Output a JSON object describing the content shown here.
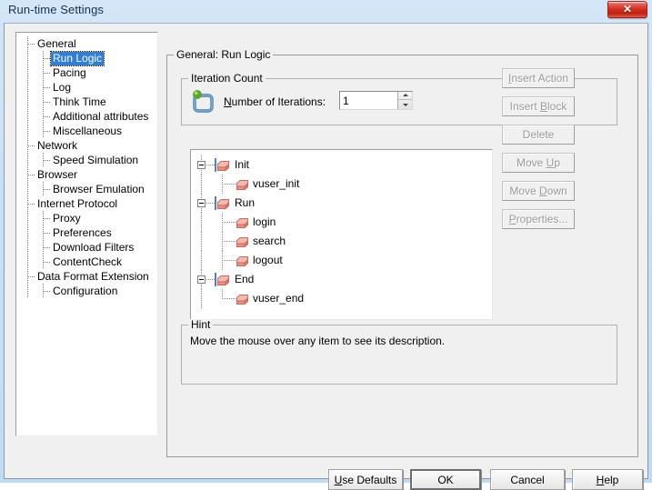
{
  "window": {
    "title": "Run-time Settings",
    "close_icon": "close-icon",
    "close_glyph": "✕"
  },
  "sidebar": {
    "items": [
      {
        "label": "General",
        "level": 0,
        "selected": false
      },
      {
        "label": "Run Logic",
        "level": 1,
        "selected": true
      },
      {
        "label": "Pacing",
        "level": 1,
        "selected": false
      },
      {
        "label": "Log",
        "level": 1,
        "selected": false
      },
      {
        "label": "Think Time",
        "level": 1,
        "selected": false
      },
      {
        "label": "Additional attributes",
        "level": 1,
        "selected": false
      },
      {
        "label": "Miscellaneous",
        "level": 1,
        "selected": false
      },
      {
        "label": "Network",
        "level": 0,
        "selected": false
      },
      {
        "label": "Speed Simulation",
        "level": 1,
        "selected": false
      },
      {
        "label": "Browser",
        "level": 0,
        "selected": false
      },
      {
        "label": "Browser Emulation",
        "level": 1,
        "selected": false
      },
      {
        "label": "Internet Protocol",
        "level": 0,
        "selected": false
      },
      {
        "label": "Proxy",
        "level": 1,
        "selected": false
      },
      {
        "label": "Preferences",
        "level": 1,
        "selected": false
      },
      {
        "label": "Download Filters",
        "level": 1,
        "selected": false
      },
      {
        "label": "ContentCheck",
        "level": 1,
        "selected": false
      },
      {
        "label": "Data Format Extension",
        "level": 0,
        "selected": false
      },
      {
        "label": "Configuration",
        "level": 1,
        "selected": false
      }
    ],
    "selection_color": "#2f7fd6"
  },
  "main": {
    "group_title": "General: Run Logic",
    "iteration": {
      "group_title": "Iteration Count",
      "icon": "iteration-loop-icon",
      "label_prefix": "",
      "label": "Number of Iterations:",
      "label_mnemonic": "N",
      "label_rest": "umber of Iterations:",
      "value": "1",
      "placeholder": ""
    },
    "actions_tree": [
      {
        "label": "Init",
        "level": 0,
        "expanded": true,
        "icon": "action-block-icon"
      },
      {
        "label": "vuser_init",
        "level": 1,
        "expanded": false,
        "icon": "action-block-icon"
      },
      {
        "label": "Run",
        "level": 0,
        "expanded": true,
        "icon": "action-block-icon"
      },
      {
        "label": "login",
        "level": 1,
        "expanded": false,
        "icon": "action-block-icon"
      },
      {
        "label": "search",
        "level": 1,
        "expanded": false,
        "icon": "action-block-icon"
      },
      {
        "label": "logout",
        "level": 1,
        "expanded": false,
        "icon": "action-block-icon"
      },
      {
        "label": "End",
        "level": 0,
        "expanded": true,
        "icon": "action-block-icon"
      },
      {
        "label": "vuser_end",
        "level": 1,
        "expanded": false,
        "icon": "action-block-icon"
      }
    ],
    "side_buttons": [
      {
        "label": "Insert Action",
        "mnemonic": "I",
        "pre": "",
        "mid": "I",
        "post": "nsert Action",
        "enabled": false
      },
      {
        "label": "Insert Block",
        "mnemonic": "B",
        "pre": "Insert ",
        "mid": "B",
        "post": "lock",
        "enabled": false
      },
      {
        "label": "Delete",
        "mnemonic": "",
        "pre": "Delete",
        "mid": "",
        "post": "",
        "enabled": false
      },
      {
        "label": "Move Up",
        "mnemonic": "U",
        "pre": "Move ",
        "mid": "U",
        "post": "p",
        "enabled": false
      },
      {
        "label": "Move Down",
        "mnemonic": "D",
        "pre": "Move ",
        "mid": "D",
        "post": "own",
        "enabled": false
      },
      {
        "label": "Properties...",
        "mnemonic": "P",
        "pre": "",
        "mid": "P",
        "post": "roperties...",
        "enabled": false
      }
    ],
    "hint": {
      "group_title": "Hint",
      "text": "Move the mouse over any item to see its description."
    }
  },
  "footer": {
    "use_defaults": {
      "label": "Use Defaults",
      "mid": "U",
      "post": "se Defaults"
    },
    "ok": {
      "label": "OK"
    },
    "cancel": {
      "label": "Cancel"
    },
    "help": {
      "label": "Help",
      "mid": "H",
      "post": "elp"
    }
  }
}
